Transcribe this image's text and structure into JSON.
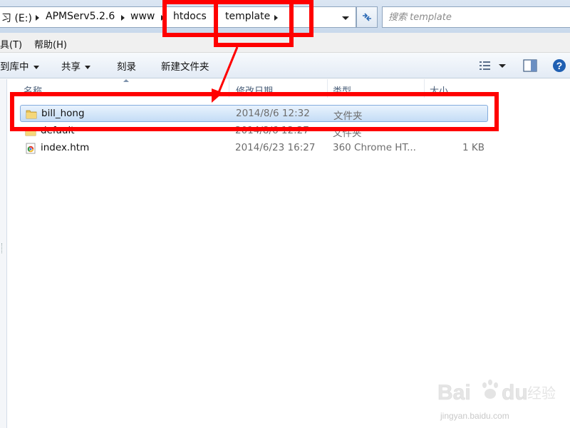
{
  "address_bar": {
    "segments": [
      "习 (E:)",
      "APMServ5.2.6",
      "www",
      "htdocs",
      "template"
    ],
    "search_placeholder": "搜索 template"
  },
  "menu_bar": {
    "items": [
      "具(T)",
      "帮助(H)"
    ]
  },
  "command_bar": {
    "items": [
      "到库中",
      "共享",
      "刻录",
      "新建文件夹"
    ]
  },
  "columns": {
    "name": "名称",
    "date_modified": "修改日期",
    "type": "类型",
    "size": "大小"
  },
  "files": [
    {
      "name": "bill_hong",
      "date": "2014/8/6 12:32",
      "type": "文件夹",
      "size": "",
      "icon": "folder-icon",
      "selected": true
    },
    {
      "name": "default",
      "date": "2014/8/6 12:27",
      "type": "文件夹",
      "size": "",
      "icon": "folder-icon",
      "selected": false
    },
    {
      "name": "index.htm",
      "date": "2014/6/23 16:27",
      "type": "360 Chrome HT...",
      "size": "1 KB",
      "icon": "chrome-html-icon",
      "selected": false
    }
  ],
  "watermark": {
    "brand": "Bai du 经验",
    "url": "jingyan.baidu.com"
  },
  "colors": {
    "annotation_red": "#ff0000",
    "selection_fill": "#c4dcf6",
    "selection_border": "#84acdd",
    "chrome_gradient": "#dbe6f3"
  }
}
